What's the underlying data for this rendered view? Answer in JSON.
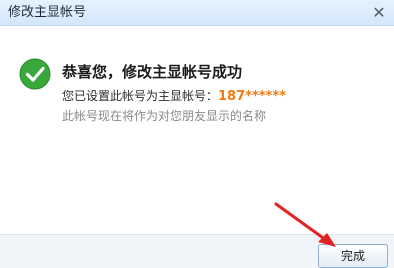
{
  "window": {
    "title": "修改主显帐号"
  },
  "message": {
    "headline": "恭喜您，修改主显帐号成功",
    "current_prefix": "您已设置此帐号为主显帐号：",
    "account": "187******",
    "note": "此帐号现在将作为对您朋友显示的名称"
  },
  "buttons": {
    "done": "完成",
    "close": "✕"
  },
  "icons": {
    "success": "check-circle",
    "close": "close",
    "arrow": "red-pointer-arrow"
  },
  "colors": {
    "success_green": "#39a83a",
    "account_orange": "#f07b12",
    "arrow_red": "#e32222",
    "titlebar": "#dbeafc"
  }
}
